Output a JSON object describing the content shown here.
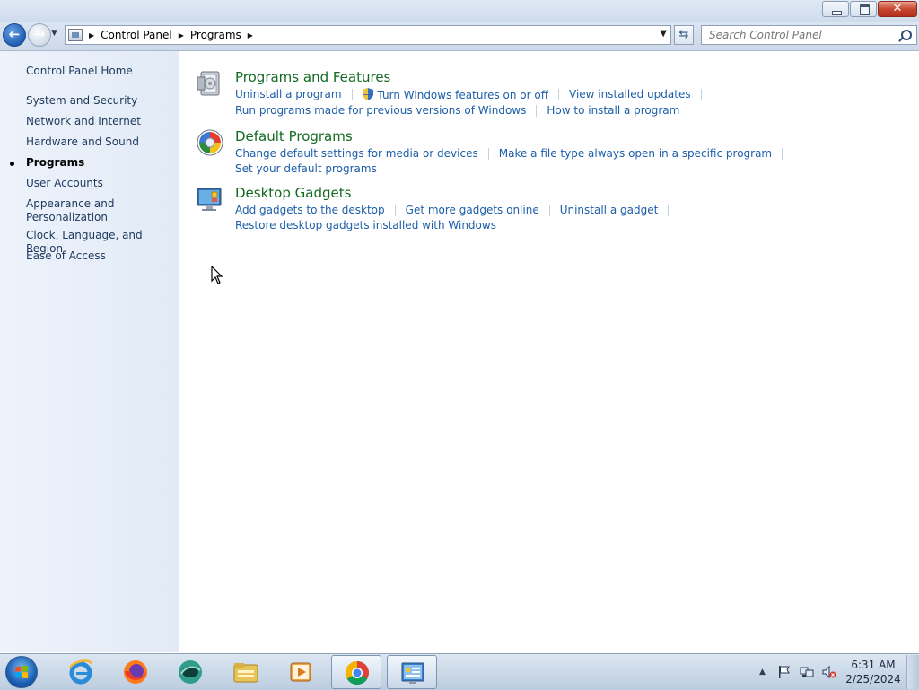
{
  "window": {
    "breadcrumb": [
      "Control Panel",
      "Programs"
    ],
    "search_placeholder": "Search Control Panel"
  },
  "sidebar": {
    "home": "Control Panel Home",
    "items": [
      {
        "label": "System and Security"
      },
      {
        "label": "Network and Internet"
      },
      {
        "label": "Hardware and Sound"
      },
      {
        "label": "Programs",
        "current": true
      },
      {
        "label": "User Accounts"
      },
      {
        "label": "Appearance and\nPersonalization"
      },
      {
        "label": "Clock, Language, and Region"
      },
      {
        "label": "Ease of Access"
      }
    ]
  },
  "categories": [
    {
      "title": "Programs and Features",
      "icon": "programs-features-icon",
      "links": [
        "Uninstall a program",
        "Turn Windows features on or off",
        "View installed updates",
        "Run programs made for previous versions of Windows",
        "How to install a program"
      ]
    },
    {
      "title": "Default Programs",
      "icon": "default-programs-icon",
      "links": [
        "Change default settings for media or devices",
        "Make a file type always open in a specific program",
        "Set your default programs"
      ]
    },
    {
      "title": "Desktop Gadgets",
      "icon": "desktop-gadgets-icon",
      "links": [
        "Add gadgets to the desktop",
        "Get more gadgets online",
        "Uninstall a gadget",
        "Restore desktop gadgets installed with Windows"
      ]
    }
  ],
  "taskbar": {
    "apps": [
      "internet-explorer-icon",
      "firefox-icon",
      "maxthon-icon",
      "file-explorer-icon",
      "media-player-icon",
      "chrome-icon",
      "control-panel-icon"
    ],
    "active_app": "control-panel-icon",
    "clock_time": "6:31 AM",
    "clock_date": "2/25/2024"
  },
  "colors": {
    "link": "#1c5ea9",
    "category_title": "#126a22",
    "sidebar_text": "#1e395b"
  }
}
